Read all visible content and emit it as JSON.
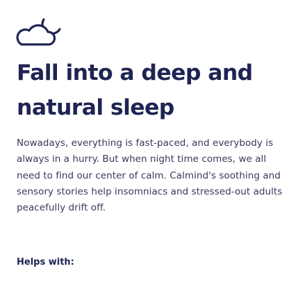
{
  "icons": {
    "logo": "cloud-moon-icon"
  },
  "colors": {
    "heading": "#1f2453",
    "body_text": "#333a56",
    "background": "#ffffff"
  },
  "hero": {
    "title_lines": [
      "Fall into a deep and",
      "natural sleep"
    ],
    "body_lines": [
      "Nowadays, everything is fast-paced, and everybody is",
      "always in a hurry. But when night time comes, we all",
      "need to find our center of calm. Calmind's soothing and",
      "sensory stories help insomniacs and stressed-out adults",
      "peacefully drift off."
    ]
  },
  "helps": {
    "label": "Helps with:"
  }
}
